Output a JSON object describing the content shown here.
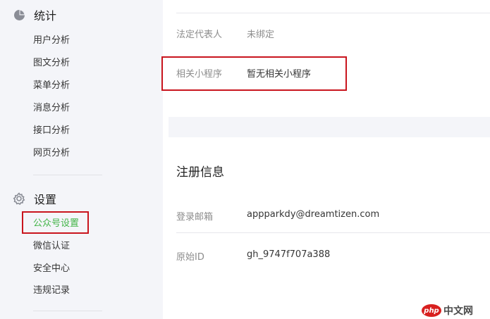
{
  "sidebar": {
    "stats": {
      "title": "统计",
      "icon": "pie-chart-icon",
      "items": [
        {
          "label": "用户分析"
        },
        {
          "label": "图文分析"
        },
        {
          "label": "菜单分析"
        },
        {
          "label": "消息分析"
        },
        {
          "label": "接口分析"
        },
        {
          "label": "网页分析"
        }
      ]
    },
    "settings": {
      "title": "设置",
      "icon": "gear-icon",
      "items": [
        {
          "label": "公众号设置",
          "active": true
        },
        {
          "label": "微信认证"
        },
        {
          "label": "安全中心"
        },
        {
          "label": "违规记录"
        }
      ]
    }
  },
  "main": {
    "legal_rep": {
      "label": "法定代表人",
      "value": "未绑定"
    },
    "mini_program": {
      "label": "相关小程序",
      "value": "暂无相关小程序"
    },
    "register_section_title": "注册信息",
    "login_email": {
      "label": "登录邮箱",
      "value": "appparkdy@dreamtizen.com"
    },
    "original_id": {
      "label": "原始ID",
      "value": "gh_9747f707a388"
    }
  },
  "watermark": {
    "badge": "php",
    "text": "中文网"
  },
  "colors": {
    "sidebar_bg": "#f4f5f9",
    "active_green": "#44b549",
    "highlight_red": "#c9151e",
    "label_gray": "#8d8d8d"
  }
}
